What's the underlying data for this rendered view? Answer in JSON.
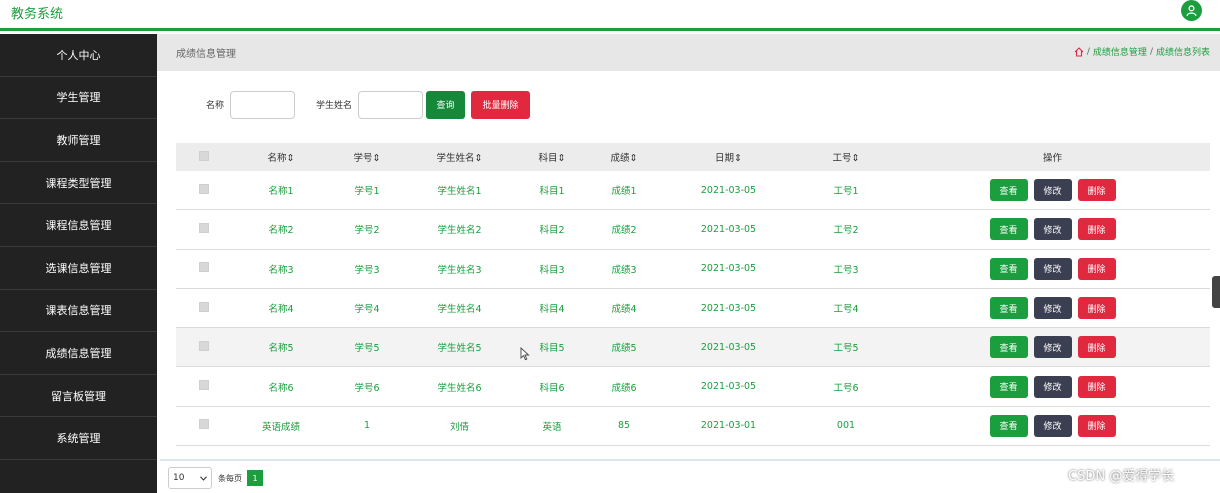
{
  "app": {
    "brand": "教务系统"
  },
  "sidebar": {
    "items": [
      {
        "label": "个人中心"
      },
      {
        "label": "学生管理"
      },
      {
        "label": "教师管理"
      },
      {
        "label": "课程类型管理"
      },
      {
        "label": "课程信息管理"
      },
      {
        "label": "选课信息管理"
      },
      {
        "label": "课表信息管理"
      },
      {
        "label": "成绩信息管理"
      },
      {
        "label": "留言板管理"
      },
      {
        "label": "系统管理"
      }
    ]
  },
  "header": {
    "title": "成绩信息管理",
    "breadcrumb": [
      "成绩信息管理",
      "成绩信息列表"
    ],
    "separator": "/"
  },
  "search": {
    "name_label": "名称",
    "name_value": "",
    "student_label": "学生姓名",
    "student_value": "",
    "query_button": "查询",
    "batch_delete_button": "批量删除"
  },
  "table": {
    "columns": [
      "名称",
      "学号",
      "学生姓名",
      "科目",
      "成绩",
      "日期",
      "工号",
      "操作"
    ],
    "sort_glyph": "⇕",
    "rows": [
      {
        "name": "名称1",
        "sid": "学号1",
        "student": "学生姓名1",
        "subject": "科目1",
        "score": "成绩1",
        "date": "2021-03-05",
        "tid": "工号1"
      },
      {
        "name": "名称2",
        "sid": "学号2",
        "student": "学生姓名2",
        "subject": "科目2",
        "score": "成绩2",
        "date": "2021-03-05",
        "tid": "工号2"
      },
      {
        "name": "名称3",
        "sid": "学号3",
        "student": "学生姓名3",
        "subject": "科目3",
        "score": "成绩3",
        "date": "2021-03-05",
        "tid": "工号3"
      },
      {
        "name": "名称4",
        "sid": "学号4",
        "student": "学生姓名4",
        "subject": "科目4",
        "score": "成绩4",
        "date": "2021-03-05",
        "tid": "工号4"
      },
      {
        "name": "名称5",
        "sid": "学号5",
        "student": "学生姓名5",
        "subject": "科目5",
        "score": "成绩5",
        "date": "2021-03-05",
        "tid": "工号5"
      },
      {
        "name": "名称6",
        "sid": "学号6",
        "student": "学生姓名6",
        "subject": "科目6",
        "score": "成绩6",
        "date": "2021-03-05",
        "tid": "工号6"
      },
      {
        "name": "英语成绩",
        "sid": "1",
        "student": "刘倩",
        "subject": "英语",
        "score": "85",
        "date": "2021-03-01",
        "tid": "001"
      }
    ],
    "actions": {
      "view": "查看",
      "edit": "修改",
      "delete": "删除"
    }
  },
  "pagination": {
    "page_size": "10",
    "per_page_label": "条每页",
    "current_page": "1"
  },
  "watermark": "CSDN @爱得学长",
  "colors": {
    "accent": "#1b9e3e",
    "danger": "#e0283f",
    "dark": "#3b3f52",
    "sidebar": "#222222"
  },
  "icons": {
    "avatar": "user-icon",
    "home": "home-icon",
    "dropdown": "chevron-down-icon",
    "cursor": "mouse-pointer-icon"
  }
}
